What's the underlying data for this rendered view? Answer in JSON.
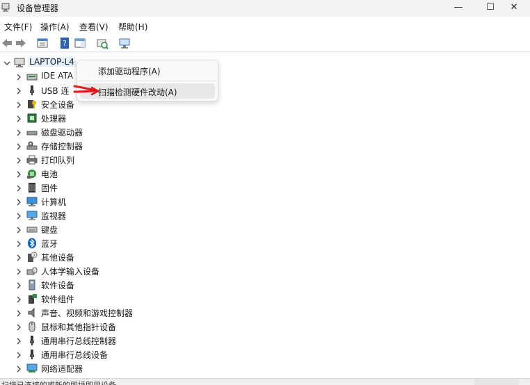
{
  "window": {
    "title": "设备管理器",
    "minimize": "—",
    "maximize": "☐",
    "close": "✕"
  },
  "menu": [
    "文件(F)",
    "操作(A)",
    "查看(V)",
    "帮助(H)"
  ],
  "toolbar_icons": [
    "back-icon",
    "forward-icon",
    "properties-icon",
    "help-icon",
    "action-pane-icon",
    "scan-hardware-icon",
    "monitor-icon"
  ],
  "tree": {
    "root": "LAPTOP-L4",
    "root_icon": "computer-icon",
    "items": [
      {
        "label": "IDE ATA",
        "icon": "ide-controller-icon"
      },
      {
        "label": "USB 连",
        "icon": "usb-connector-icon"
      },
      {
        "label": "安全设备",
        "icon": "security-device-icon"
      },
      {
        "label": "处理器",
        "icon": "processor-icon"
      },
      {
        "label": "磁盘驱动器",
        "icon": "disk-drive-icon"
      },
      {
        "label": "存储控制器",
        "icon": "storage-controller-icon"
      },
      {
        "label": "打印队列",
        "icon": "printer-icon"
      },
      {
        "label": "电池",
        "icon": "battery-icon"
      },
      {
        "label": "固件",
        "icon": "firmware-icon"
      },
      {
        "label": "计算机",
        "icon": "computer-icon"
      },
      {
        "label": "监视器",
        "icon": "monitor-icon"
      },
      {
        "label": "键盘",
        "icon": "keyboard-icon"
      },
      {
        "label": "蓝牙",
        "icon": "bluetooth-icon"
      },
      {
        "label": "其他设备",
        "icon": "other-device-icon"
      },
      {
        "label": "人体学输入设备",
        "icon": "hid-icon"
      },
      {
        "label": "软件设备",
        "icon": "software-device-icon"
      },
      {
        "label": "软件组件",
        "icon": "software-component-icon"
      },
      {
        "label": "声音、视频和游戏控制器",
        "icon": "audio-icon"
      },
      {
        "label": "鼠标和其他指针设备",
        "icon": "mouse-icon"
      },
      {
        "label": "通用串行总线控制器",
        "icon": "usb-icon"
      },
      {
        "label": "通用串行总线设备",
        "icon": "usb-icon"
      },
      {
        "label": "网络适配器",
        "icon": "network-adapter-icon"
      }
    ]
  },
  "context_menu": {
    "items": [
      "添加驱动程序(A)",
      "扫描检测硬件改动(A)"
    ],
    "highlighted_index": 1
  },
  "status": {
    "text": "扫描已连接的或新的即插即用设备"
  },
  "colors": {
    "titlebar": "#f3f3f3",
    "root_selected": "#e5f1fb",
    "annotation_arrow": "#e0191b",
    "bluetooth": "#0a62c9"
  }
}
